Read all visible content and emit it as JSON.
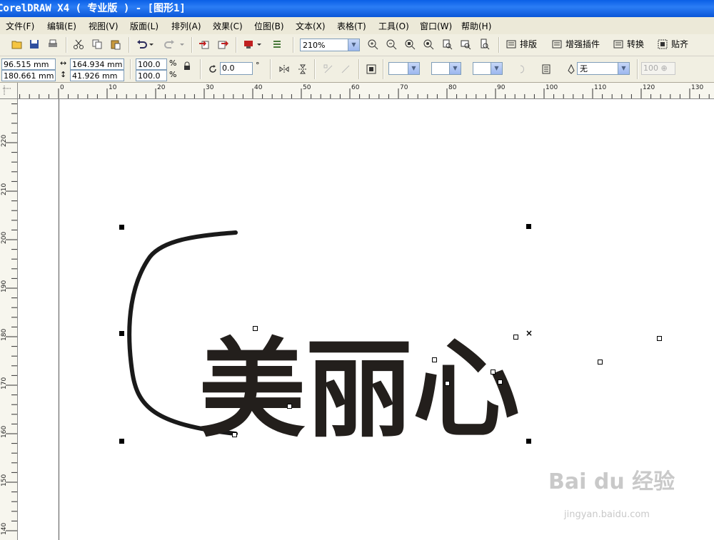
{
  "window": {
    "title": "CorelDRAW X4 ( 专业版 ) - [图形1]"
  },
  "menu": [
    {
      "label": "文件(F)"
    },
    {
      "label": "编辑(E)"
    },
    {
      "label": "视图(V)"
    },
    {
      "label": "版面(L)"
    },
    {
      "label": "排列(A)"
    },
    {
      "label": "效果(C)"
    },
    {
      "label": "位图(B)"
    },
    {
      "label": "文本(X)"
    },
    {
      "label": "表格(T)"
    },
    {
      "label": "工具(O)"
    },
    {
      "label": "窗口(W)"
    },
    {
      "label": "帮助(H)"
    }
  ],
  "toolbar": {
    "zoom": "210%",
    "plugins": [
      {
        "label": "排版"
      },
      {
        "label": "增强插件"
      },
      {
        "label": "转换"
      },
      {
        "label": "贴齐"
      }
    ]
  },
  "property_bar": {
    "x": "96.515 mm",
    "y": "180.661 mm",
    "width": "164.934 mm",
    "height": "41.926 mm",
    "scale_w": "100.0",
    "scale_h": "100.0",
    "percent": "%",
    "rotation": "0.0",
    "degree": "°",
    "outline": "无",
    "outline_percent": "100"
  },
  "rulers": {
    "top_ticks": [
      "0",
      "10",
      "20",
      "30",
      "40",
      "50",
      "60",
      "70",
      "80",
      "90",
      "100",
      "110",
      "120",
      "130"
    ],
    "left_ticks": [
      "220",
      "210",
      "200",
      "190",
      "180",
      "170",
      "160",
      "150",
      "140"
    ]
  },
  "artwork": {
    "text": "美丽心"
  },
  "watermark": {
    "brand": "Bai du 经验",
    "url": "jingyan.baidu.com"
  }
}
